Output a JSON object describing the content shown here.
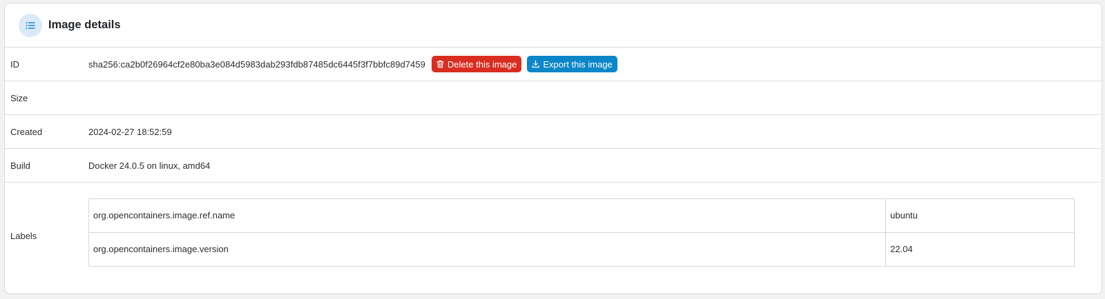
{
  "card": {
    "title": "Image details",
    "icon": "list-icon"
  },
  "details": {
    "id": {
      "label": "ID",
      "value": "sha256:ca2b0f26964cf2e80ba3e084d5983dab293fdb87485dc6445f3f7bbfc89d7459",
      "delete_button": "Delete this image",
      "export_button": "Export this image"
    },
    "size": {
      "label": "Size",
      "value": ""
    },
    "created": {
      "label": "Created",
      "value": "2024-02-27 18:52:59"
    },
    "build": {
      "label": "Build",
      "value": "Docker 24.0.5 on linux, amd64"
    },
    "labels": {
      "label": "Labels",
      "items": [
        {
          "key": "org.opencontainers.image.ref.name",
          "value": "ubuntu"
        },
        {
          "key": "org.opencontainers.image.version",
          "value": "22.04"
        }
      ]
    }
  },
  "colors": {
    "danger": "#d92d20",
    "export": "#0b86c9",
    "icon_bg": "#dbeaf8",
    "icon_fg": "#1b7fd1"
  }
}
